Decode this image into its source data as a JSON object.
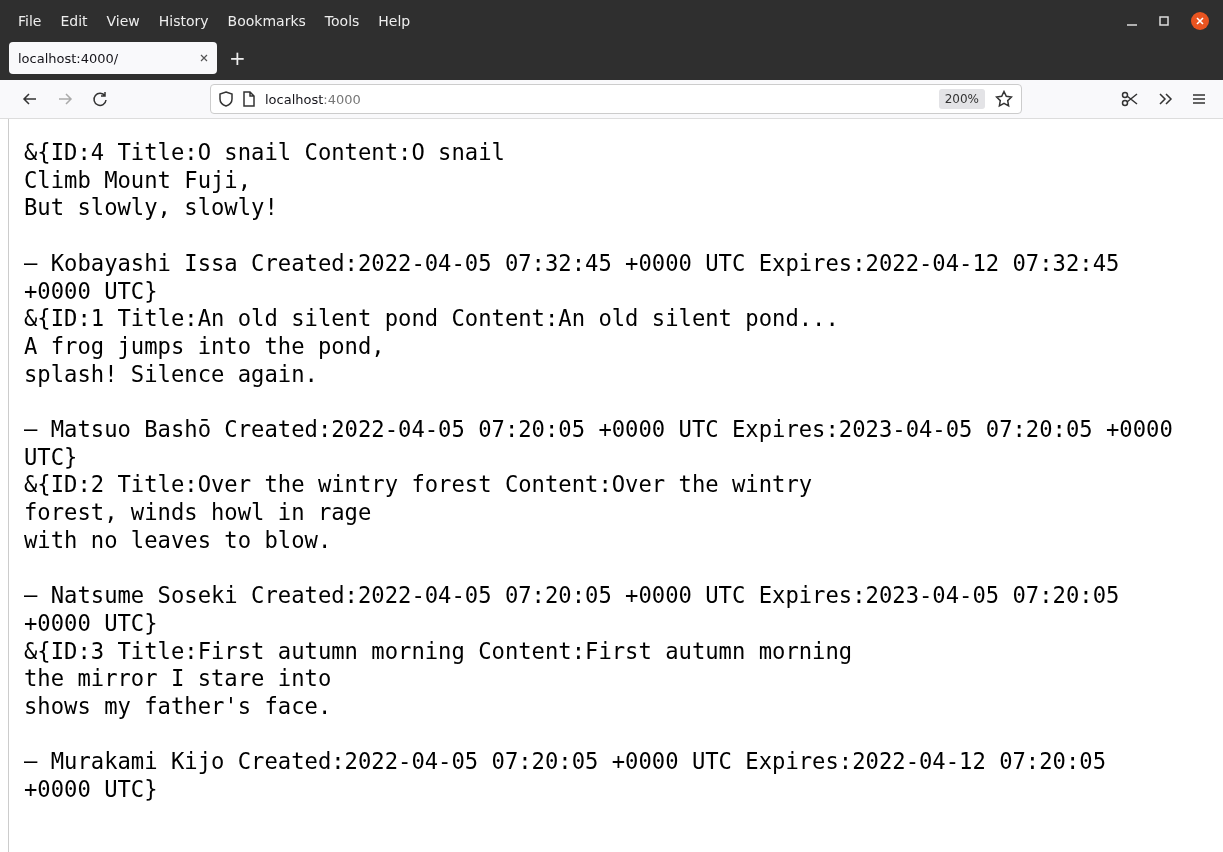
{
  "menu": [
    "File",
    "Edit",
    "View",
    "History",
    "Bookmarks",
    "Tools",
    "Help"
  ],
  "tabs": [
    {
      "label": "localhost:4000/",
      "selected": true
    }
  ],
  "new_tab": "+",
  "address_bar": {
    "host": "localhost",
    "port": ":4000",
    "zoom": "200%"
  },
  "page": {
    "blocks": [
      [
        "&{ID:4 Title:O snail Content:O snail",
        "Climb Mount Fuji,",
        "But slowly, slowly!"
      ],
      [
        "— Kobayashi Issa Created:2022-04-05 07:32:45 +0000 UTC Expires:2022-04-12 07:32:45",
        "+0000 UTC}",
        "&{ID:1 Title:An old silent pond Content:An old silent pond...",
        "A frog jumps into the pond,",
        "splash! Silence again."
      ],
      [
        "— Matsuo Bashō Created:2022-04-05 07:20:05 +0000 UTC Expires:2023-04-05 07:20:05 +0000",
        "UTC}",
        "&{ID:2 Title:Over the wintry forest Content:Over the wintry",
        "forest, winds howl in rage",
        "with no leaves to blow."
      ],
      [
        "— Natsume Soseki Created:2022-04-05 07:20:05 +0000 UTC Expires:2023-04-05 07:20:05",
        "+0000 UTC}",
        "&{ID:3 Title:First autumn morning Content:First autumn morning",
        "the mirror I stare into",
        "shows my father's face."
      ],
      [
        "— Murakami Kijo Created:2022-04-05 07:20:05 +0000 UTC Expires:2022-04-12 07:20:05",
        "+0000 UTC}"
      ]
    ]
  }
}
